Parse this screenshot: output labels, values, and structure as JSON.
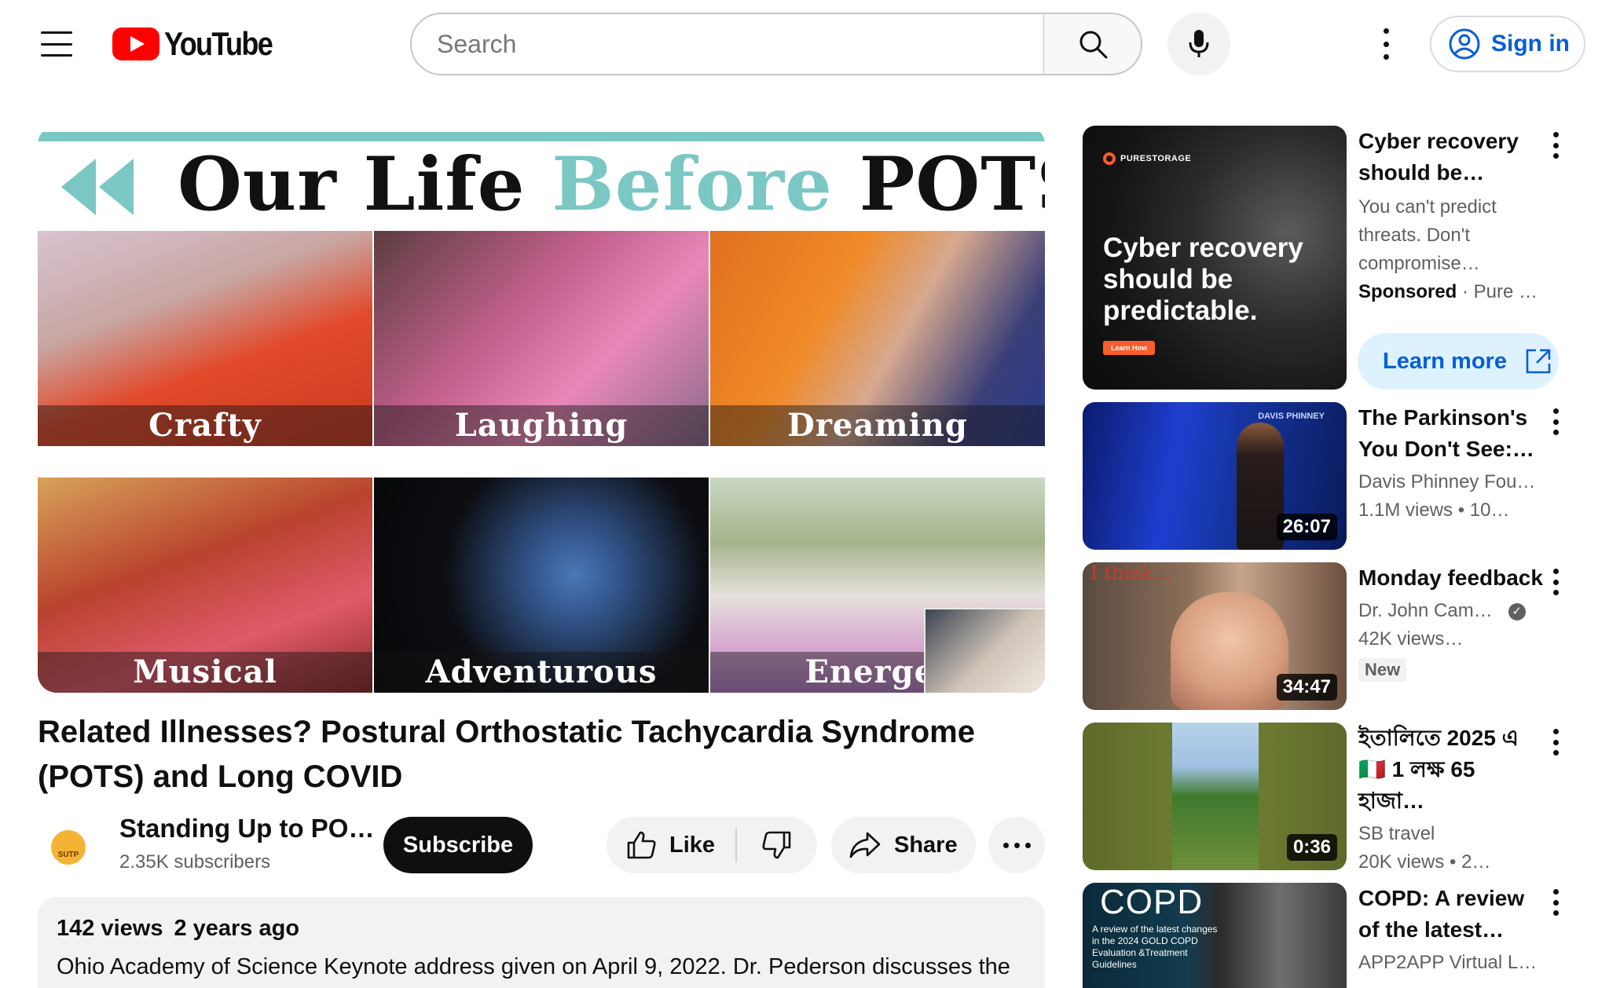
{
  "header": {
    "logo_text": "YouTube",
    "search_placeholder": "Search",
    "sign_in_label": "Sign in"
  },
  "thumbnail": {
    "banner_title_part1": "Our Life ",
    "banner_title_accent": "Before",
    "banner_title_part2": " POTS",
    "captions": [
      "Crafty",
      "Laughing",
      "Dreaming",
      "Musical",
      "Adventurous",
      "Energet"
    ]
  },
  "video": {
    "title": "Related Illnesses? Postural Orthostatic Tachycardia Syndrome (POTS) and Long COVID",
    "channel_name": "Standing Up to PO…",
    "channel_avatar_text": "SUTP",
    "subscribers": "2.35K subscribers",
    "subscribe_label": "Subscribe",
    "like_label": "Like",
    "share_label": "Share",
    "views": "142 views",
    "age": "2 years ago",
    "description": "Ohio Academy of Science Keynote address given on April 9, 2022. Dr. Pederson discusses the possible relationship between POTS, long COVID, and mast cell activation syndrome (MCAS)."
  },
  "sidebar": {
    "ad": {
      "title": "Cyber recovery should be…",
      "description": "You can't predict threats. Don't compromise…",
      "sponsored_label": "Sponsored",
      "advertiser": "Pure …",
      "thumb_brand": "PURESTORAGE",
      "thumb_headline": "Cyber recovery should be predictable.",
      "thumb_cta": "Learn How",
      "learn_more_label": "Learn more"
    },
    "items": [
      {
        "title": "The Parkinson's You Don't See:…",
        "channel": "Davis Phinney Fou…",
        "views": "1.1M views",
        "age": "10…",
        "duration": "26:07",
        "thumb_brand": "DAVIS PHINNEY"
      },
      {
        "title": "Monday feedback",
        "channel": "Dr. John Cam…",
        "views": "42K views…",
        "badge": "New",
        "duration": "34:47",
        "thumb_text": "I think..."
      },
      {
        "title": "ইতালিতে 2025 এ 🇮🇹 1 লক্ষ 65 হাজা…",
        "channel": "SB travel",
        "views": "20K views",
        "age": "2…",
        "duration": "0:36"
      },
      {
        "title": "COPD: A review of the latest…",
        "channel": "APP2APP Virtual L…",
        "thumb_title": "COPD",
        "thumb_subtitle": "A review of the latest changes in the 2024 GOLD COPD Evaluation &Treatment Guidelines"
      }
    ]
  }
}
